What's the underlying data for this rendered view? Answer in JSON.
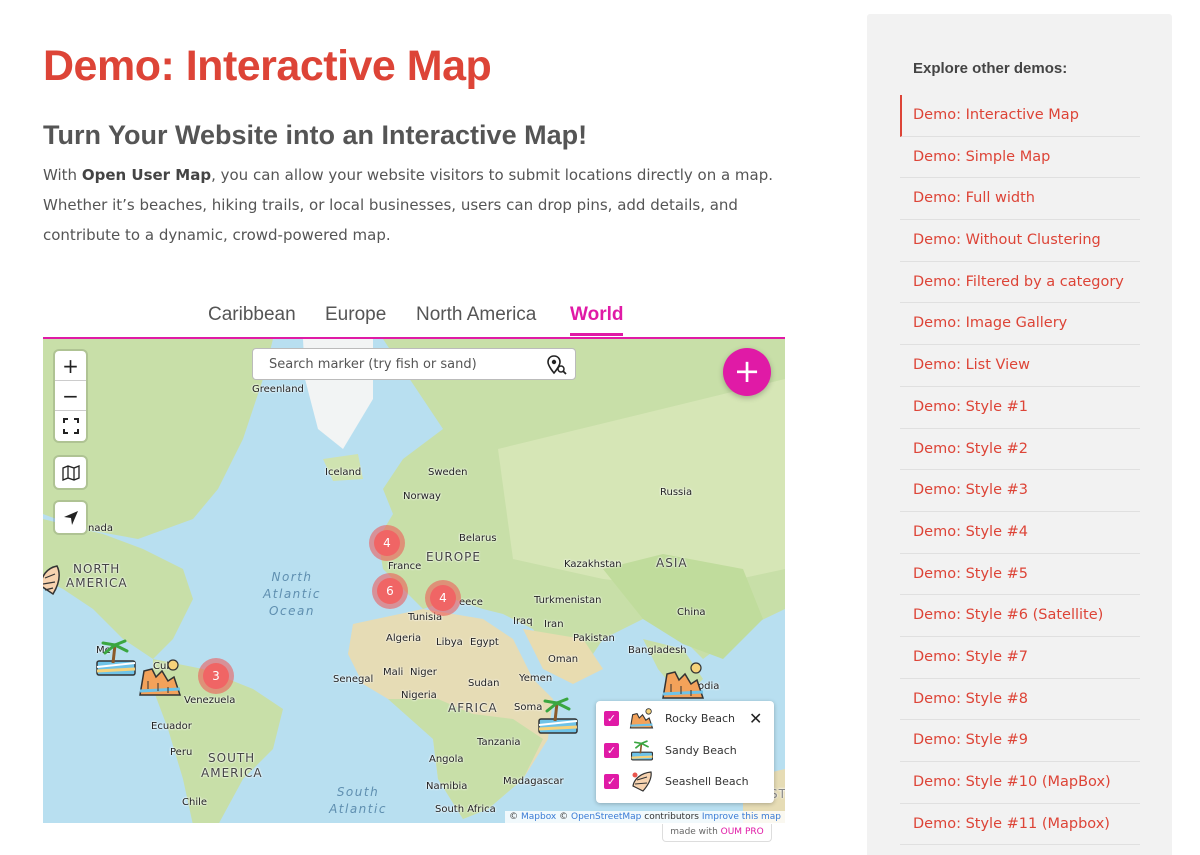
{
  "page": {
    "title": "Demo: Interactive Map",
    "subheading": "Turn Your Website into an Interactive Map!",
    "intro_prefix": "With ",
    "intro_bold": "Open User Map",
    "intro_rest": ", you can allow your website visitors to submit locations directly on a map. Whether it’s beaches, hiking trails, or local businesses, users can drop pins, add details, and contribute to a dynamic, crowd-powered map."
  },
  "tabs": [
    {
      "label": "Caribbean",
      "active": false
    },
    {
      "label": "Europe",
      "active": false
    },
    {
      "label": "North America",
      "active": false
    },
    {
      "label": "World",
      "active": true
    }
  ],
  "map": {
    "search_placeholder": "Search marker (try fish or sand)",
    "zoom_in": "+",
    "zoom_out": "−",
    "add_button": "+",
    "clusters": [
      "4",
      "6",
      "4",
      "3"
    ],
    "labels": {
      "greenland": "Greenland",
      "iceland": "Iceland",
      "sweden": "Sweden",
      "norway": "Norway",
      "russia": "Russia",
      "canada": "nada",
      "belarus": "Belarus",
      "europe": "EUROPE",
      "kazakhstan": "Kazakhstan",
      "asia": "ASIA",
      "north_america_1": "NORTH",
      "north_america_2": "AMERICA",
      "north_atlantic_1": "North",
      "north_atlantic_2": "Atlantic",
      "north_atlantic_3": "Ocean",
      "france": "France",
      "greece": "eece",
      "turkmenistan": "Turkmenistan",
      "china": "China",
      "tunisia": "Tunisia",
      "iraq": "Iraq",
      "iran": "Iran",
      "algeria": "Algeria",
      "libya": "Libya",
      "egypt": "Egypt",
      "pakistan": "Pakistan",
      "bangladesh": "Bangladesh",
      "oman": "Oman",
      "mali": "Mali",
      "niger": "Niger",
      "senegal": "Senegal",
      "sudan": "Sudan",
      "yemen": "Yemen",
      "nigeria": "Nigeria",
      "africa": "AFRICA",
      "somalia": "Soma",
      "venezuela": "Venezuela",
      "ecuador": "Ecuador",
      "peru": "Peru",
      "south_america_1": "SOUTH",
      "south_america_2": "AMERICA",
      "tanzania": "Tanzania",
      "angola": "Angola",
      "madagascar": "Madagascar",
      "namibia": "Namibia",
      "chile": "Chile",
      "south_africa": "South Africa",
      "south_atlantic_1": "South",
      "south_atlantic_2": "Atlantic",
      "austr": "AUSTR",
      "mexico": "Me",
      "cuba": "Cub",
      "odia": "odia"
    },
    "legend": [
      {
        "label": "Rocky Beach",
        "checked": true,
        "icon": "rocky-beach-icon"
      },
      {
        "label": "Sandy Beach",
        "checked": true,
        "icon": "sandy-beach-icon"
      },
      {
        "label": "Seashell Beach",
        "checked": true,
        "icon": "seashell-beach-icon"
      }
    ],
    "legend_close": "✕",
    "attribution": {
      "copy1": "© ",
      "mapbox": "Mapbox",
      "copy2": " © ",
      "osm": "OpenStreetMap",
      "contributors": " contributors ",
      "improve": "Improve this map"
    },
    "made_with": "made with ",
    "made_with_pro": "OUM PRO"
  },
  "sidebar": {
    "title": "Explore other demos:",
    "items": [
      {
        "label": "Demo: Interactive Map",
        "active": true
      },
      {
        "label": "Demo: Simple Map"
      },
      {
        "label": "Demo: Full width"
      },
      {
        "label": "Demo: Without Clustering"
      },
      {
        "label": "Demo: Filtered by a category"
      },
      {
        "label": "Demo: Image Gallery"
      },
      {
        "label": "Demo: List View"
      },
      {
        "label": "Demo: Style #1"
      },
      {
        "label": "Demo: Style #2"
      },
      {
        "label": "Demo: Style #3"
      },
      {
        "label": "Demo: Style #4"
      },
      {
        "label": "Demo: Style #5"
      },
      {
        "label": "Demo: Style #6 (Satellite)"
      },
      {
        "label": "Demo: Style #7"
      },
      {
        "label": "Demo: Style #8"
      },
      {
        "label": "Demo: Style #9"
      },
      {
        "label": "Demo: Style #10 (MapBox)"
      },
      {
        "label": "Demo: Style #11 (Mapbox)"
      }
    ]
  },
  "colors": {
    "title_red": "#dd4437",
    "accent_magenta": "#e01aa6",
    "cluster_red": "#f06565",
    "ocean": "#b8dff0",
    "land": "#c8dfa8"
  }
}
